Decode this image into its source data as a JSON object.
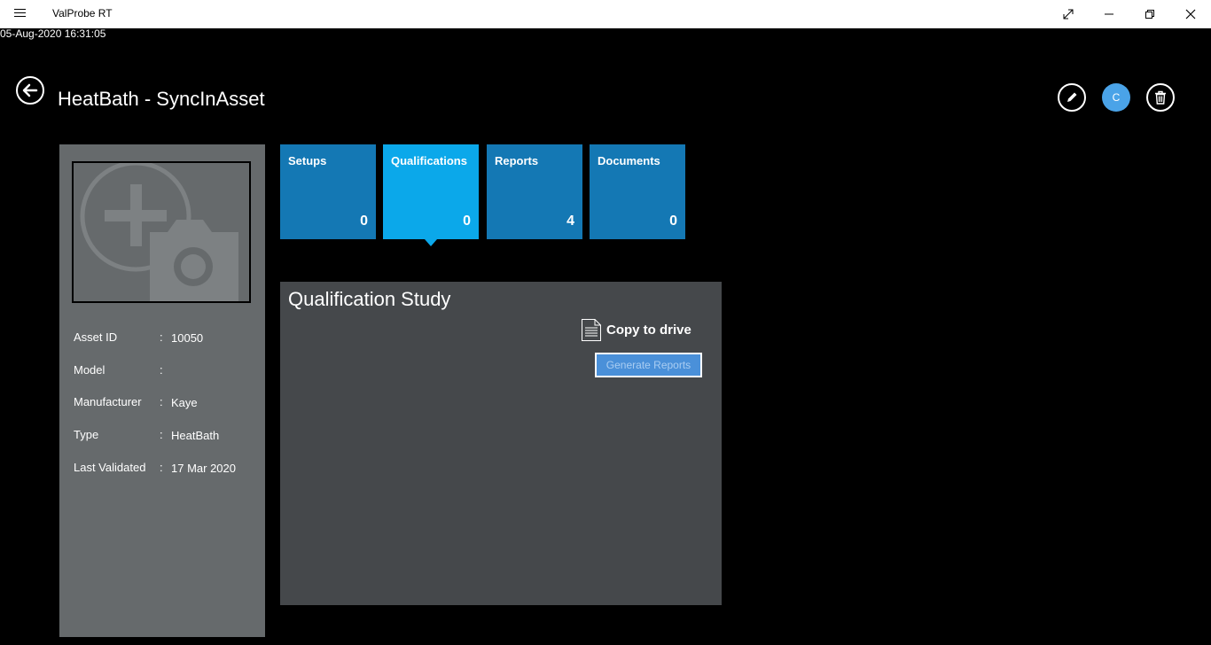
{
  "window": {
    "title": "ValProbe RT",
    "timestamp": "05-Aug-2020 16:31:05"
  },
  "header": {
    "title": "HeatBath - SyncInAsset",
    "user_initial": "C"
  },
  "asset": {
    "fields": [
      {
        "label": "Asset ID",
        "value": "10050"
      },
      {
        "label": "Model",
        "value": ""
      },
      {
        "label": "Manufacturer",
        "value": "Kaye"
      },
      {
        "label": "Type",
        "value": "HeatBath"
      },
      {
        "label": "Last Validated",
        "value": "17 Mar 2020"
      }
    ],
    "separator": ":"
  },
  "tiles": [
    {
      "label": "Setups",
      "count": "0",
      "active": false
    },
    {
      "label": "Qualifications",
      "count": "0",
      "active": true
    },
    {
      "label": "Reports",
      "count": "4",
      "active": false
    },
    {
      "label": "Documents",
      "count": "0",
      "active": false
    }
  ],
  "study": {
    "title": "Qualification Study",
    "copy_label": "Copy to drive",
    "generate_label": "Generate Reports"
  },
  "colors": {
    "tile": "#1478b4",
    "tile_active": "#0ba8ea",
    "panel": "#666a6c",
    "study_panel": "#45484b",
    "accent": "#4aa3e8"
  },
  "icons": [
    "menu-icon",
    "maximize-icon",
    "minimize-icon",
    "restore-icon",
    "close-icon",
    "back-arrow-icon",
    "pencil-icon",
    "trash-icon",
    "add-photo-icon",
    "document-icon"
  ]
}
